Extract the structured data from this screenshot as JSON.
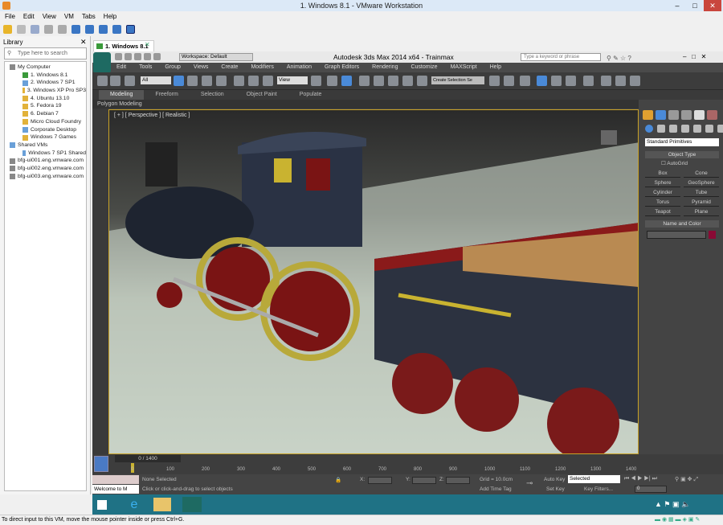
{
  "window": {
    "title": "1. Windows 8.1 - VMware Workstation",
    "minimize": "–",
    "maximize": "□",
    "close": "✕"
  },
  "menu": [
    "File",
    "Edit",
    "View",
    "VM",
    "Tabs",
    "Help"
  ],
  "library": {
    "title": "Library",
    "close": "✕",
    "search_placeholder": "Type here to search",
    "tree": [
      {
        "label": "My Computer",
        "level": 0,
        "icon": "computer-icon"
      },
      {
        "label": "1. Windows 8.1",
        "level": 1,
        "icon": "vm-running-icon"
      },
      {
        "label": "2. Windows 7 SP1",
        "level": 1,
        "icon": "vm-icon"
      },
      {
        "label": "3. Windows XP Pro SP3",
        "level": 1,
        "icon": "vm-folder-icon"
      },
      {
        "label": "4. Ubuntu 13.10",
        "level": 1,
        "icon": "vm-folder-icon"
      },
      {
        "label": "5. Fedora 19",
        "level": 1,
        "icon": "vm-folder-icon"
      },
      {
        "label": "6. Debian 7",
        "level": 1,
        "icon": "vm-folder-icon"
      },
      {
        "label": "Micro Cloud Foundry",
        "level": 1,
        "icon": "vm-folder-icon"
      },
      {
        "label": "Corporate Desktop",
        "level": 1,
        "icon": "vm-icon"
      },
      {
        "label": "Windows 7 Games",
        "level": 1,
        "icon": "vm-folder-icon"
      },
      {
        "label": "Shared VMs",
        "level": 0,
        "icon": "shared-icon"
      },
      {
        "label": "Windows 7 SP1 Shared",
        "level": 1,
        "icon": "vm-icon"
      },
      {
        "label": "bfg-ui001.eng.vmware.com",
        "level": 0,
        "icon": "server-icon"
      },
      {
        "label": "bfg-ui002.eng.vmware.com",
        "level": 0,
        "icon": "server-icon"
      },
      {
        "label": "bfg-ui003.eng.vmware.com",
        "level": 0,
        "icon": "server-icon"
      }
    ]
  },
  "vm_tab": {
    "label": "1. Windows 8.1",
    "close": "✕"
  },
  "max": {
    "workspace": "Workspace: Default",
    "title": "Autodesk 3ds Max  2014 x64  - Trainmax",
    "search_placeholder": "Type a keyword or phrase",
    "menu": [
      "Edit",
      "Tools",
      "Group",
      "Views",
      "Create",
      "Modifiers",
      "Animation",
      "Graph Editors",
      "Rendering",
      "Customize",
      "MAXScript",
      "Help"
    ],
    "filter": "All",
    "ref_coord": "View",
    "selection_set": "Create Selection Se",
    "ribbon_tabs": [
      "Modeling",
      "Freeform",
      "Selection",
      "Object Paint",
      "Populate"
    ],
    "ribbon_sub": "Polygon Modeling",
    "viewport_label": "[ + ] [ Perspective ] [ Realistic ]",
    "command_panel": {
      "category": "Standard Primitives",
      "object_type_title": "Object Type",
      "autogrid": "AutoGrid",
      "buttons": [
        "Box",
        "Cone",
        "Sphere",
        "GeoSphere",
        "Cylinder",
        "Tube",
        "Torus",
        "Pyramid",
        "Teapot",
        "Plane"
      ],
      "name_color_title": "Name and Color",
      "object_color": "#8a0a35"
    },
    "timeline": {
      "frame": "0 / 1400",
      "ticks": [
        "0",
        "100",
        "200",
        "300",
        "400",
        "500",
        "600",
        "700",
        "800",
        "900",
        "1000",
        "1100",
        "1200",
        "1300",
        "1400"
      ]
    },
    "status": {
      "selection": "None Selected",
      "prompt": "Click or click-and-drag to select objects",
      "maxscript": "Welcome to M",
      "x_label": "X:",
      "y_label": "Y:",
      "z_label": "Z:",
      "grid": "Grid = 10.0cm",
      "add_time_tag": "Add Time Tag",
      "auto_key": "Auto Key",
      "set_key": "Set Key",
      "key_mode": "Selected",
      "key_filters": "Key Filters...",
      "current_frame": "0"
    }
  },
  "vm_status": "To direct input to this VM, move the mouse pointer inside or press Ctrl+G.",
  "colors": {
    "taskbar": "#1f7285",
    "viewport_border": "#c9a227",
    "max_bg": "#444444"
  }
}
